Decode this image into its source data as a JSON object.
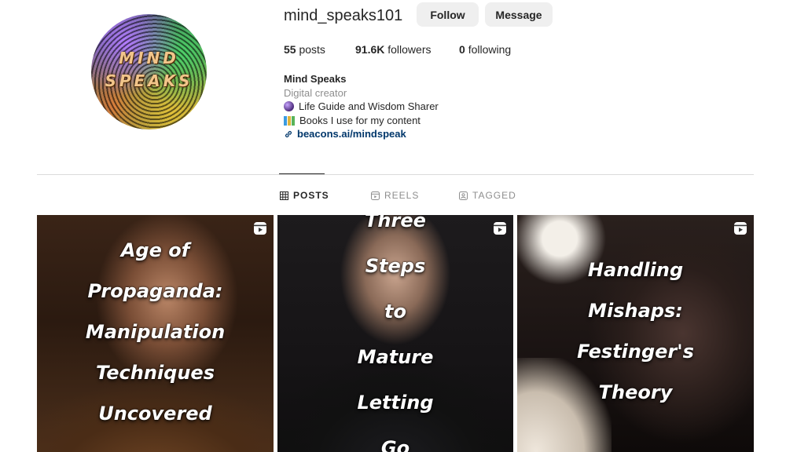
{
  "profile": {
    "avatar_text_line1": "MIND",
    "avatar_text_line2": "SPEAKS",
    "username": "mind_speaks101",
    "follow_label": "Follow",
    "message_label": "Message",
    "stats": {
      "posts_count": "55",
      "posts_label": "posts",
      "followers_count": "91.6K",
      "followers_label": "followers",
      "following_count": "0",
      "following_label": "following"
    },
    "bio": {
      "name": "Mind Speaks",
      "category": "Digital creator",
      "line1_icon": "crystal-ball-icon",
      "line1": "Life Guide and Wisdom Sharer",
      "line2_icon": "books-icon",
      "line2": "Books I use for my content",
      "link": "beacons.ai/mindspeak"
    }
  },
  "tabs": [
    {
      "label": "POSTS",
      "icon": "grid-icon",
      "active": true
    },
    {
      "label": "REELS",
      "icon": "reels-icon",
      "active": false
    },
    {
      "label": "TAGGED",
      "icon": "tagged-icon",
      "active": false
    }
  ],
  "posts": [
    {
      "caption_lines": [
        "Age of",
        "Propaganda:",
        "Manipulation",
        "Techniques",
        "Uncovered"
      ],
      "type_icon": "reel-icon"
    },
    {
      "caption_lines": [
        "Three",
        "Steps",
        "to",
        "Mature",
        "Letting",
        "Go"
      ],
      "type_icon": "reel-icon"
    },
    {
      "caption_lines": [
        "Handling",
        "Mishaps:",
        "Festinger's",
        "Theory"
      ],
      "type_icon": "reel-icon"
    }
  ],
  "colors": {
    "link": "#00376b",
    "button_bg": "#efefef",
    "divider": "#dbdbdb",
    "muted_text": "#8e8e8e"
  }
}
